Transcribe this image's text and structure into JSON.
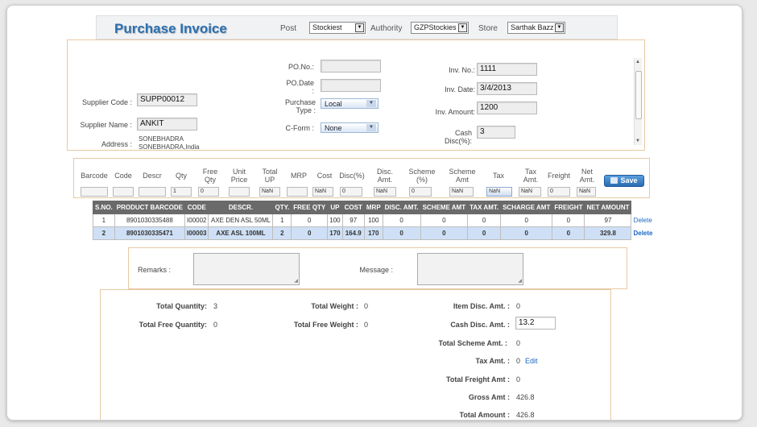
{
  "header": {
    "title": "Purchase Invoice",
    "post_label": "Post",
    "post_value": "Stockiest",
    "authority_label": "Authority",
    "authority_value": "GZPStockies",
    "store_label": "Store",
    "store_value": "Sarthak Bazz"
  },
  "supplier": {
    "code_label": "Supplier Code :",
    "code_value": "SUPP00012",
    "name_label": "Supplier Name :",
    "name_value": "ANKIT",
    "address_label": "Address :",
    "address_line1": "SONEBHADRA",
    "address_line2": "SONEBHADRA,India"
  },
  "po": {
    "po_no_label": "PO.No.:",
    "po_no_value": "",
    "po_date_label_1": "PO.Date",
    "po_date_label_2": ":",
    "po_date_value": "",
    "purchase_type_label_1": "Purchase",
    "purchase_type_label_2": "Type :",
    "purchase_type_value": "Local",
    "cform_label": "C-Form :",
    "cform_value": "None"
  },
  "invoice": {
    "inv_no_label": "Inv. No.:",
    "inv_no_value": "1111",
    "inv_date_label": "Inv. Date:",
    "inv_date_value": "3/4/2013",
    "inv_amount_label": "Inv. Amount:",
    "inv_amount_value": "1200",
    "cash_disc_label_1": "Cash",
    "cash_disc_label_2": "Disc(%):",
    "cash_disc_value": "3"
  },
  "entry": {
    "headers": [
      {
        "l1": "Barcode",
        "l2": ""
      },
      {
        "l1": "Code",
        "l2": ""
      },
      {
        "l1": "Descr",
        "l2": ""
      },
      {
        "l1": "Qty",
        "l2": ""
      },
      {
        "l1": "Free",
        "l2": "Qty"
      },
      {
        "l1": "Unit",
        "l2": "Price"
      },
      {
        "l1": "Total",
        "l2": "UP"
      },
      {
        "l1": "MRP",
        "l2": ""
      },
      {
        "l1": "Cost",
        "l2": ""
      },
      {
        "l1": "Disc(%)",
        "l2": ""
      },
      {
        "l1": "Disc.",
        "l2": "Amt."
      },
      {
        "l1": "Scheme",
        "l2": "(%)"
      },
      {
        "l1": "Scheme",
        "l2": "Amt"
      },
      {
        "l1": "Tax",
        "l2": ""
      },
      {
        "l1": "Tax",
        "l2": "Amt."
      },
      {
        "l1": "Freight",
        "l2": ""
      },
      {
        "l1": "Net",
        "l2": "Amt."
      }
    ],
    "values": [
      "",
      "",
      "",
      "1",
      "0",
      "",
      "NaN",
      "",
      "NaN",
      "0",
      "NaN",
      "0",
      "NaN",
      "NaN",
      "NaN",
      "0",
      "NaN"
    ],
    "save_label": "Save"
  },
  "grid": {
    "columns": [
      "S.NO.",
      "PRODUCT BARCODE",
      "CODE",
      "DESCR.",
      "QTY.",
      "FREE QTY",
      "UP",
      "COST",
      "MRP",
      "DISC. AMT.",
      "SCHEME AMT",
      "TAX AMT.",
      "SCHARGE AMT",
      "FREIGHT",
      "NET AMOUNT"
    ],
    "rows": [
      [
        "1",
        "8901030335488",
        "I00002",
        "AXE DEN ASL 50ML",
        "1",
        "0",
        "100",
        "97",
        "100",
        "0",
        "0",
        "0",
        "0",
        "0",
        "97"
      ],
      [
        "2",
        "8901030335471",
        "I00003",
        "AXE ASL 100ML",
        "2",
        "0",
        "170",
        "164.9",
        "170",
        "0",
        "0",
        "0",
        "0",
        "0",
        "329.8"
      ]
    ],
    "delete_label": "Delete"
  },
  "remarks": {
    "remarks_label": "Remarks :",
    "message_label": "Message :"
  },
  "totals": {
    "total_qty_label": "Total Quantity:",
    "total_qty_value": "3",
    "total_free_qty_label": "Total Free Quantity:",
    "total_free_qty_value": "0",
    "total_weight_label": "Total Weight :",
    "total_weight_value": "0",
    "total_free_weight_label": "Total Free Weight :",
    "total_free_weight_value": "0",
    "item_disc_label": "Item Disc. Amt. :",
    "item_disc_value": "0",
    "cash_disc_label": "Cash Disc. Amt. :",
    "cash_disc_value": "13.2",
    "scheme_label": "Total Scheme Amt. :",
    "scheme_value": "0",
    "tax_label": "Tax Amt. :",
    "tax_value": "0",
    "tax_edit": "Edit",
    "freight_label": "Total Freight Amt :",
    "freight_value": "0",
    "gross_label": "Gross Amt :",
    "gross_value": "426.8",
    "total_amount_label": "Total Amount :",
    "total_amount_value": "426.8"
  }
}
